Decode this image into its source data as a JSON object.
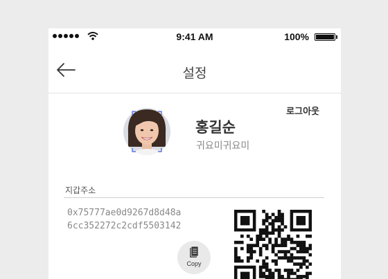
{
  "status_bar": {
    "time": "9:41 AM",
    "battery_percent": "100%",
    "battery_level": 1.0
  },
  "header": {
    "title": "설정",
    "back_icon": "arrow-left-icon"
  },
  "profile": {
    "logout_label": "로그아웃",
    "name": "홍길순",
    "user_id": "귀요미귀요미",
    "avatar_icon": "avatar-photo"
  },
  "wallet": {
    "label": "지갑주소",
    "address_line1": "0x75777ae0d9267d8d48a",
    "address_line2": "6cc352272c2cdf5503142",
    "copy_label": "Copy",
    "copy_icon": "document-copy-icon"
  },
  "colors": {
    "background": "#ececec",
    "panel": "#ffffff",
    "text_dark": "#333333",
    "text_muted": "#888888",
    "divider": "#cfcfcf"
  }
}
